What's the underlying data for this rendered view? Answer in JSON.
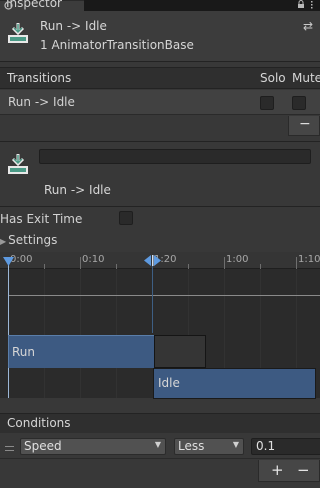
{
  "tab": {
    "title": "Inspector"
  },
  "header": {
    "title": "Run -> Idle",
    "subtitle": "1 AnimatorTransitionBase"
  },
  "transitions": {
    "heading": "Transitions",
    "col_solo": "Solo",
    "col_mute": "Mute",
    "rows": [
      {
        "label": "Run -> Idle",
        "solo": false,
        "mute": false
      }
    ],
    "remove_label": "−"
  },
  "detail": {
    "name": "Run -> Idle"
  },
  "settings": {
    "has_exit_time_label": "Has Exit Time",
    "has_exit_time": false,
    "foldout_label": "Settings"
  },
  "timeline": {
    "ticks": [
      "0:00",
      "0:10",
      "1:20",
      "1:00",
      "1:10"
    ],
    "source_state": "Run",
    "dest_state": "Idle"
  },
  "conditions": {
    "heading": "Conditions",
    "items": [
      {
        "parameter": "Speed",
        "mode": "Less",
        "value": "0.1"
      }
    ],
    "add_label": "+",
    "remove_label": "−"
  },
  "colors": {
    "accent_blue": "#3d5a82",
    "panel_bg": "#383838"
  }
}
